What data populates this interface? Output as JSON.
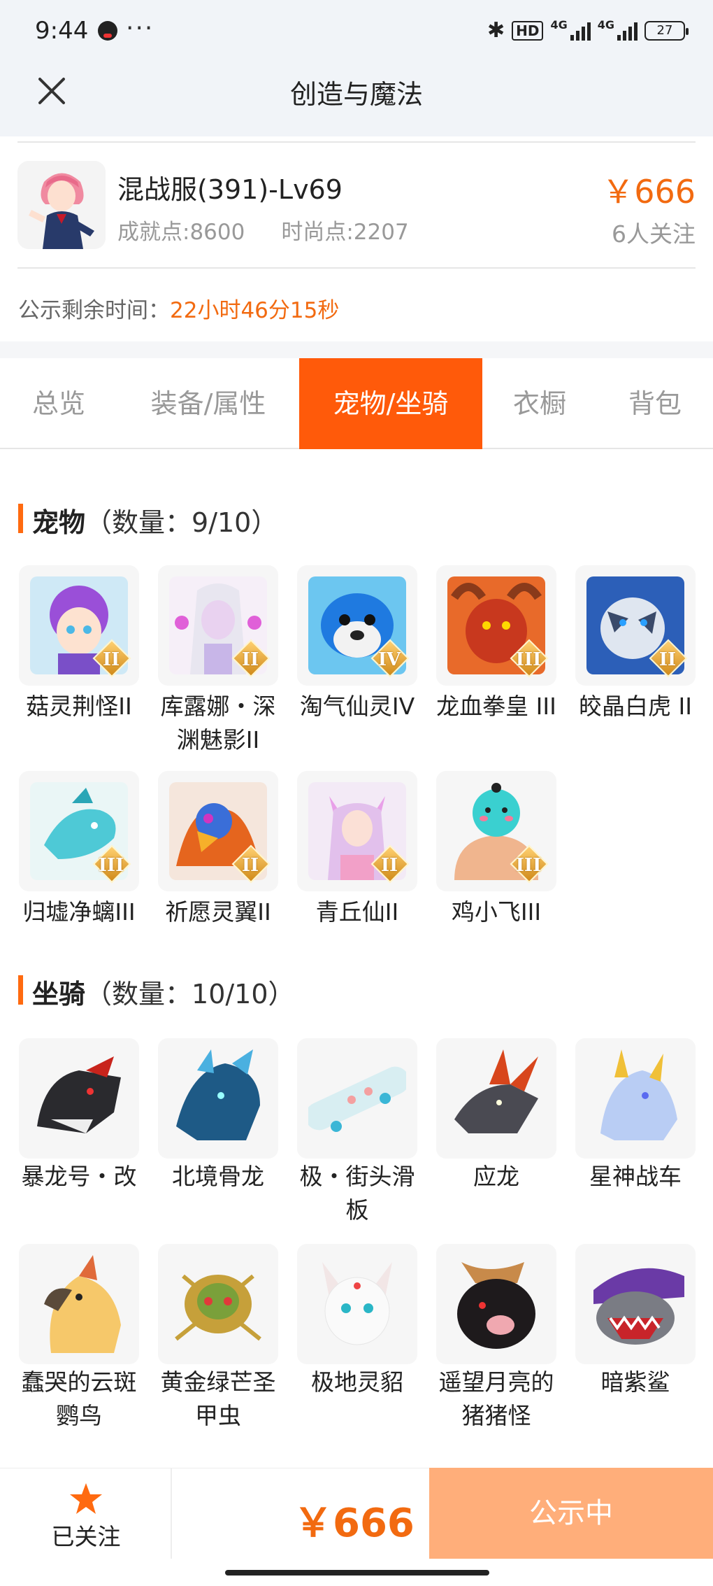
{
  "status_bar": {
    "time": "9:44",
    "more": "···",
    "hd": "HD",
    "net1": "4G",
    "net2": "4G",
    "battery": "27"
  },
  "header": {
    "title": "创造与魔法"
  },
  "account": {
    "name": "混战服(391)-Lv69",
    "achievement": "成就点:8600",
    "fashion": "时尚点:2207",
    "price": "￥666",
    "followers": "6人关注",
    "timer_label": "公示剩余时间：",
    "timer_value": "22小时46分15秒"
  },
  "tabs": [
    "总览",
    "装备/属性",
    "宠物/坐骑",
    "衣橱",
    "背包"
  ],
  "active_tab": "宠物/坐骑",
  "pets": {
    "title": "宠物",
    "count": "（数量：9/10）",
    "items": [
      {
        "name": "菇灵荆怪II",
        "tier": "II"
      },
      {
        "name": "库露娜・深渊魅影II",
        "tier": "II"
      },
      {
        "name": "淘气仙灵IV",
        "tier": "IV"
      },
      {
        "name": "龙血拳皇 III",
        "tier": "III"
      },
      {
        "name": "皎晶白虎 II",
        "tier": "II"
      },
      {
        "name": "归墟净螭III",
        "tier": "III"
      },
      {
        "name": "祈愿灵翼II",
        "tier": "II"
      },
      {
        "name": "青丘仙II",
        "tier": "II"
      },
      {
        "name": "鸡小飞III",
        "tier": "III"
      }
    ]
  },
  "mounts": {
    "title": "坐骑",
    "count": "（数量：10/10）",
    "items": [
      {
        "name": "暴龙号・改"
      },
      {
        "name": "北境骨龙"
      },
      {
        "name": "极・街头滑板"
      },
      {
        "name": "应龙"
      },
      {
        "name": "星神战车"
      },
      {
        "name": "蠢哭的云斑鹦鸟"
      },
      {
        "name": "黄金绿芒圣甲虫"
      },
      {
        "name": "极地灵貂"
      },
      {
        "name": "遥望月亮的猪猪怪"
      },
      {
        "name": "暗紫鲨"
      }
    ]
  },
  "bottom_bar": {
    "followed": "已关注",
    "price": "￥666",
    "action": "公示中"
  },
  "colors": {
    "accent": "#ff5a0a",
    "price": "#f26a10",
    "cta": "#ffae7a"
  }
}
